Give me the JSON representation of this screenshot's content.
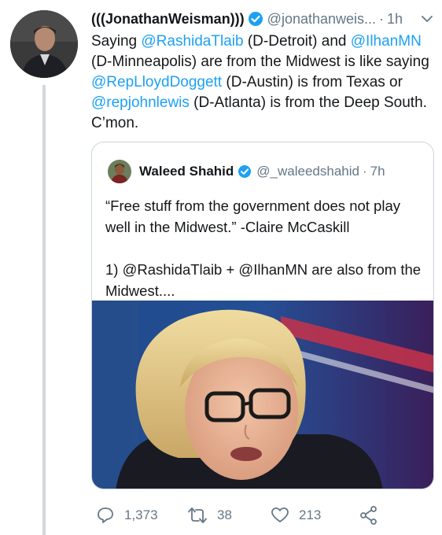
{
  "tweet": {
    "author_name": "(((JonathanWeisman)))",
    "author_handle": "@jonathanweis...",
    "separator": "·",
    "time": "1h",
    "text": {
      "t1": "Saying ",
      "m1": "@RashidaTlaib",
      "t2": " (D-Detroit) and ",
      "m2": "@IlhanMN",
      "t3": " (D-Minneapolis) are from the Midwest is like saying ",
      "m3": "@RepLloydDoggett",
      "t4": " (D-Austin) is from Texas or ",
      "m4": "@repjohnlewis",
      "t5": " (D-Atlanta) is from the Deep South. C’mon."
    }
  },
  "quote": {
    "author_name": "Waleed Shahid",
    "author_handle": "@_waleedshahid",
    "separator": "·",
    "time": "7h",
    "paragraph1": "“Free stuff from the government does not play well in the Midwest.” -Claire McCaskill",
    "paragraph2": "1) @RashidaTlaib + @IlhanMN are also from the Midwest...."
  },
  "actions": {
    "replies": "1,373",
    "retweets": "38",
    "likes": "213"
  },
  "colors": {
    "link": "#1da1f2",
    "secondary": "#657786",
    "border": "#ccd6dd"
  }
}
